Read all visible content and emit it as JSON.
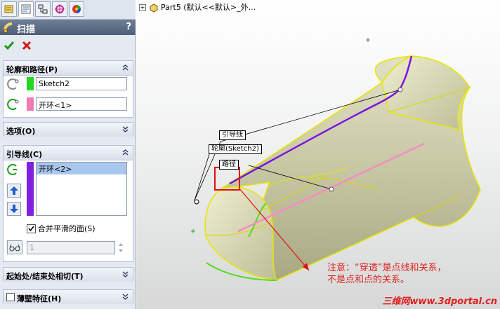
{
  "panel": {
    "title": "扫描",
    "help": "?",
    "tabs": [
      "feature-manager-icon",
      "property-manager-icon",
      "configuration-manager-icon",
      "dimxpert-icon",
      "appearance-icon"
    ],
    "groups": {
      "profile_path": {
        "label": "轮廓和路径(P)",
        "profile_value": "Sketch2",
        "profile_color": "#22d822",
        "path_value": "开环<1>",
        "path_color": "#f07ab4"
      },
      "options": {
        "label": "选项(O)"
      },
      "guides": {
        "label": "引导线(C)",
        "items": [
          "开环<2>"
        ],
        "list_color": "#8020e0",
        "merge_label": "合并平滑的面(S)",
        "merge_checked": true,
        "spinner_value": "1"
      },
      "tangency": {
        "label": "起始处/结束处相切(T)"
      },
      "thin": {
        "label": "薄壁特征(H)"
      }
    }
  },
  "viewport": {
    "tree_label": "Part5  (默认<<默认>_外...",
    "callouts": {
      "guide": "引导线",
      "profile": "轮廓(Sketch2)",
      "path": "路径"
    },
    "note_line1": "注意：“穿透”是点线和关系，",
    "note_line2": "不是点和点的关系。",
    "watermark": "三维网www.3dportal.cn"
  }
}
